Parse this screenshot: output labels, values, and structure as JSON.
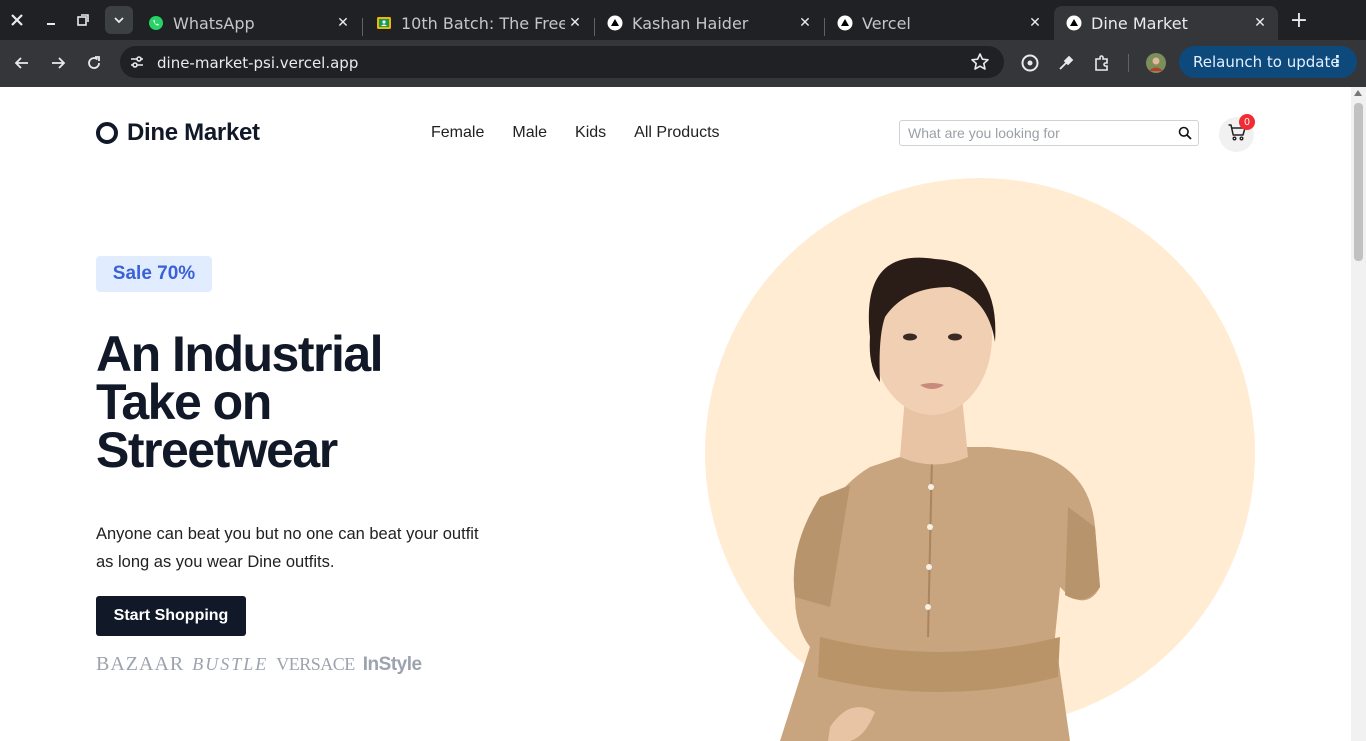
{
  "browser": {
    "tabs": [
      {
        "title": "WhatsApp",
        "favicon": "whatsapp-icon",
        "active": false
      },
      {
        "title": "10th Batch: The Free",
        "favicon": "classroom-icon",
        "active": false
      },
      {
        "title": "Kashan Haider",
        "favicon": "vercel-icon",
        "active": false
      },
      {
        "title": "Vercel",
        "favicon": "vercel-icon",
        "active": false
      },
      {
        "title": "Dine Market",
        "favicon": "vercel-icon",
        "active": true
      }
    ],
    "url": "dine-market-psi.vercel.app",
    "relaunch_label": "Relaunch to update"
  },
  "site": {
    "logo_text": "Dine Market",
    "nav": [
      "Female",
      "Male",
      "Kids",
      "All Products"
    ],
    "search_placeholder": "What are you looking for",
    "cart_count": "0"
  },
  "hero": {
    "badge": "Sale 70%",
    "headline_lines": [
      "An Industrial",
      "Take on",
      "Streetwear"
    ],
    "subtext_lines": [
      "Anyone can beat you but no one can beat your outfit",
      "as long as you wear Dine outfits."
    ],
    "cta_label": "Start Shopping",
    "brands": [
      "BAZAAR",
      "BUSTLE",
      "VERSACE",
      "InStyle"
    ]
  },
  "colors": {
    "accent_dark": "#111827",
    "badge_bg": "#e1edff",
    "badge_text": "#3a61d6",
    "hero_circle": "#ffecd2",
    "relaunch_bg": "#0e497b"
  }
}
